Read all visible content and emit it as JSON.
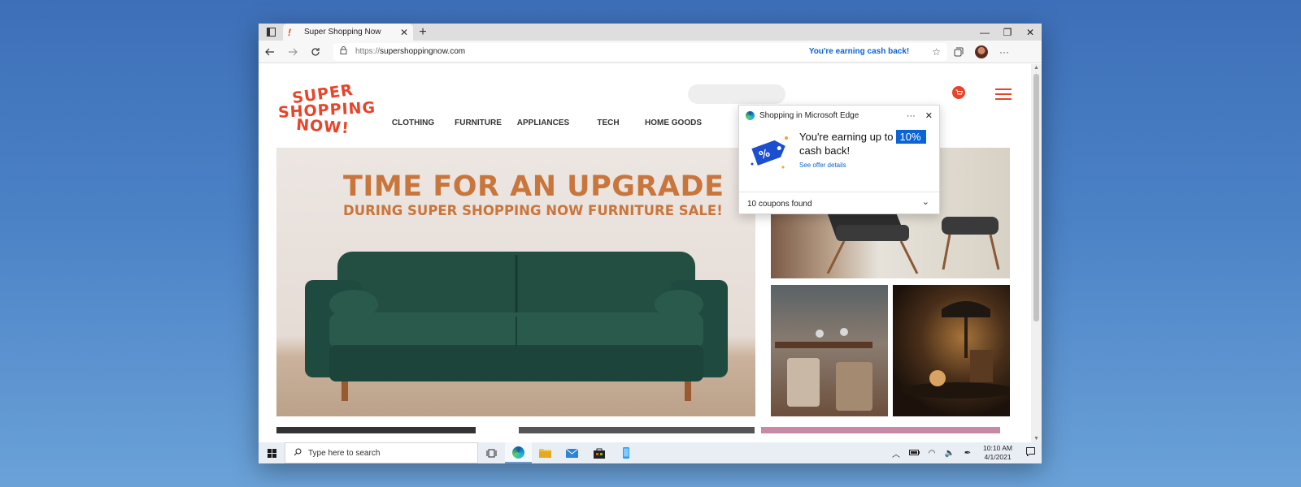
{
  "browser": {
    "tab_title": "Super Shopping Now",
    "tab_favicon": "!",
    "tab_close": "✕",
    "new_tab": "+",
    "url_protocol": "https://",
    "url_host": "supershoppingnow.com",
    "cashback_text": "You're earning cash back!",
    "window_controls": {
      "minimize": "—",
      "maximize": "❐",
      "close": "✕"
    },
    "icons": [
      "tab-actions-icon",
      "back-icon",
      "forward-icon",
      "refresh-icon",
      "lock-icon",
      "favorites-star-icon",
      "collections-icon",
      "profile-avatar",
      "more-icon"
    ]
  },
  "site": {
    "logo_lines": [
      "SUPER",
      "SHOPPING",
      "NOW!"
    ],
    "nav": [
      "CLOTHING",
      "FURNITURE",
      "APPLIANCES",
      "TECH",
      "HOME GOODS"
    ],
    "hero_title": "TIME FOR AN UPGRADE",
    "hero_subtitle": "DURING SUPER SHOPPING NOW FURNITURE SALE!",
    "colors": {
      "brand": "#e8442a",
      "hero_text": "#c9763d",
      "sofa": "#1f4a3f"
    }
  },
  "shopping_panel": {
    "title": "Shopping in Microsoft Edge",
    "more": "···",
    "close": "✕",
    "offer_prefix": "You're earning up to",
    "offer_badge": "10%",
    "offer_suffix": "cash back!",
    "details_link": "See offer details",
    "coupons": "10 coupons found",
    "expand": "⌄",
    "accent": "#0a64d6"
  },
  "taskbar": {
    "search_placeholder": "Type here to search",
    "time": "10:10 AM",
    "date": "4/1/2021",
    "pinned": [
      "task-view-icon",
      "edge-icon",
      "file-explorer-icon",
      "mail-icon",
      "store-icon",
      "phone-icon"
    ],
    "tray": [
      "show-hidden-icon",
      "battery-icon",
      "network-icon",
      "volume-icon",
      "pen-icon"
    ]
  }
}
